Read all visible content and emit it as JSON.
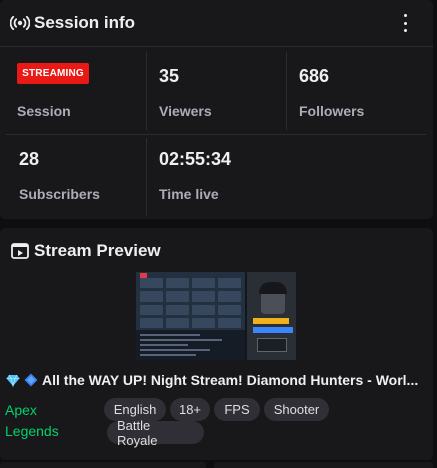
{
  "session_panel": {
    "title": "Session info",
    "icon": "broadcast-icon",
    "status_badge": "STREAMING",
    "stats": {
      "session": {
        "label": "Session"
      },
      "viewers": {
        "value": "35",
        "label": "Viewers"
      },
      "followers": {
        "value": "686",
        "label": "Followers"
      },
      "subscribers": {
        "value": "28",
        "label": "Subscribers"
      },
      "time_live": {
        "value": "02:55:34",
        "label": "Time live"
      }
    }
  },
  "preview_panel": {
    "title": "Stream Preview",
    "icon": "stream-preview-icon",
    "stream_title": "All the WAY UP! Night Stream! Diamond Hunters - Worl...",
    "game": "Apex Legends",
    "tags": [
      "English",
      "18+",
      "FPS",
      "Shooter",
      "Battle Royale"
    ]
  },
  "colors": {
    "background": "#0e0e10",
    "panel": "#18181b",
    "live_red": "#e91916",
    "game_green": "#00d26a",
    "tag_bg": "#2f2f35",
    "muted_text": "#adadb8"
  }
}
